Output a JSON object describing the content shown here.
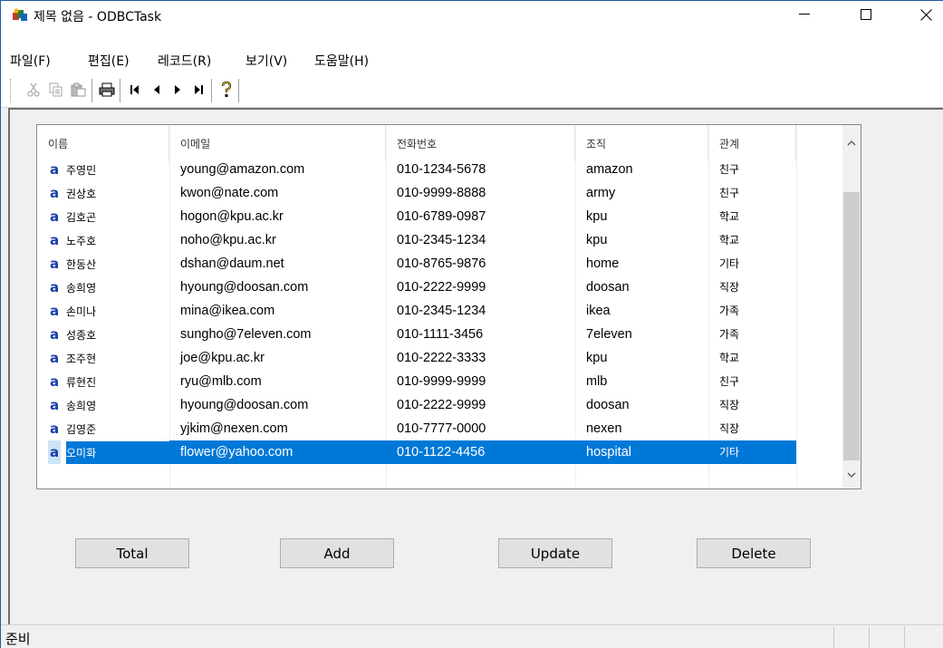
{
  "window": {
    "title": "제목 없음 - ODBCTask",
    "minimize": "—",
    "maximize": "☐",
    "close": "✕"
  },
  "menu": [
    {
      "label": "파일(F)"
    },
    {
      "label": "편집(E)"
    },
    {
      "label": "레코드(R)"
    },
    {
      "label": "보기(V)"
    },
    {
      "label": "도움말(H)"
    }
  ],
  "toolbar": {
    "icons": [
      "cut-icon",
      "copy-icon",
      "paste-icon",
      "print-icon",
      "first-record-icon",
      "prev-record-icon",
      "next-record-icon",
      "last-record-icon",
      "help-icon"
    ]
  },
  "list": {
    "columns": [
      "이름",
      "이메일",
      "전화번호",
      "조직",
      "관계"
    ],
    "row_icon": "a",
    "rows": [
      {
        "name": "주영민",
        "email": "young@amazon.com",
        "phone": "010-1234-5678",
        "org": "amazon",
        "rel": "친구"
      },
      {
        "name": "권상호",
        "email": "kwon@nate.com",
        "phone": "010-9999-8888",
        "org": "army",
        "rel": "친구"
      },
      {
        "name": "김호곤",
        "email": "hogon@kpu.ac.kr",
        "phone": "010-6789-0987",
        "org": "kpu",
        "rel": "학교"
      },
      {
        "name": "노주호",
        "email": "noho@kpu.ac.kr",
        "phone": "010-2345-1234",
        "org": "kpu",
        "rel": "학교"
      },
      {
        "name": "한동산",
        "email": "dshan@daum.net",
        "phone": "010-8765-9876",
        "org": "home",
        "rel": "기타"
      },
      {
        "name": "송희영",
        "email": "hyoung@doosan.com",
        "phone": "010-2222-9999",
        "org": "doosan",
        "rel": "직장"
      },
      {
        "name": "손미나",
        "email": "mina@ikea.com",
        "phone": "010-2345-1234",
        "org": "ikea",
        "rel": "가족"
      },
      {
        "name": "성종호",
        "email": "sungho@7eleven.com",
        "phone": "010-1111-3456",
        "org": "7eleven",
        "rel": "가족"
      },
      {
        "name": "조주현",
        "email": "joe@kpu.ac.kr",
        "phone": "010-2222-3333",
        "org": "kpu",
        "rel": "학교"
      },
      {
        "name": "류현진",
        "email": "ryu@mlb.com",
        "phone": "010-9999-9999",
        "org": "mlb",
        "rel": "친구"
      },
      {
        "name": "송희영",
        "email": "hyoung@doosan.com",
        "phone": "010-2222-9999",
        "org": "doosan",
        "rel": "직장"
      },
      {
        "name": "김영준",
        "email": "yjkim@nexen.com",
        "phone": "010-7777-0000",
        "org": "nexen",
        "rel": "직장"
      },
      {
        "name": "오미화",
        "email": "flower@yahoo.com",
        "phone": "010-1122-4456",
        "org": "hospital",
        "rel": "기타"
      }
    ],
    "selected_index": 12
  },
  "buttons": {
    "total": "Total",
    "add": "Add",
    "update": "Update",
    "delete": "Delete"
  },
  "status": {
    "text": "준비"
  },
  "colors": {
    "selection": "#0078d7",
    "row_icon": "#1a3ea8"
  }
}
